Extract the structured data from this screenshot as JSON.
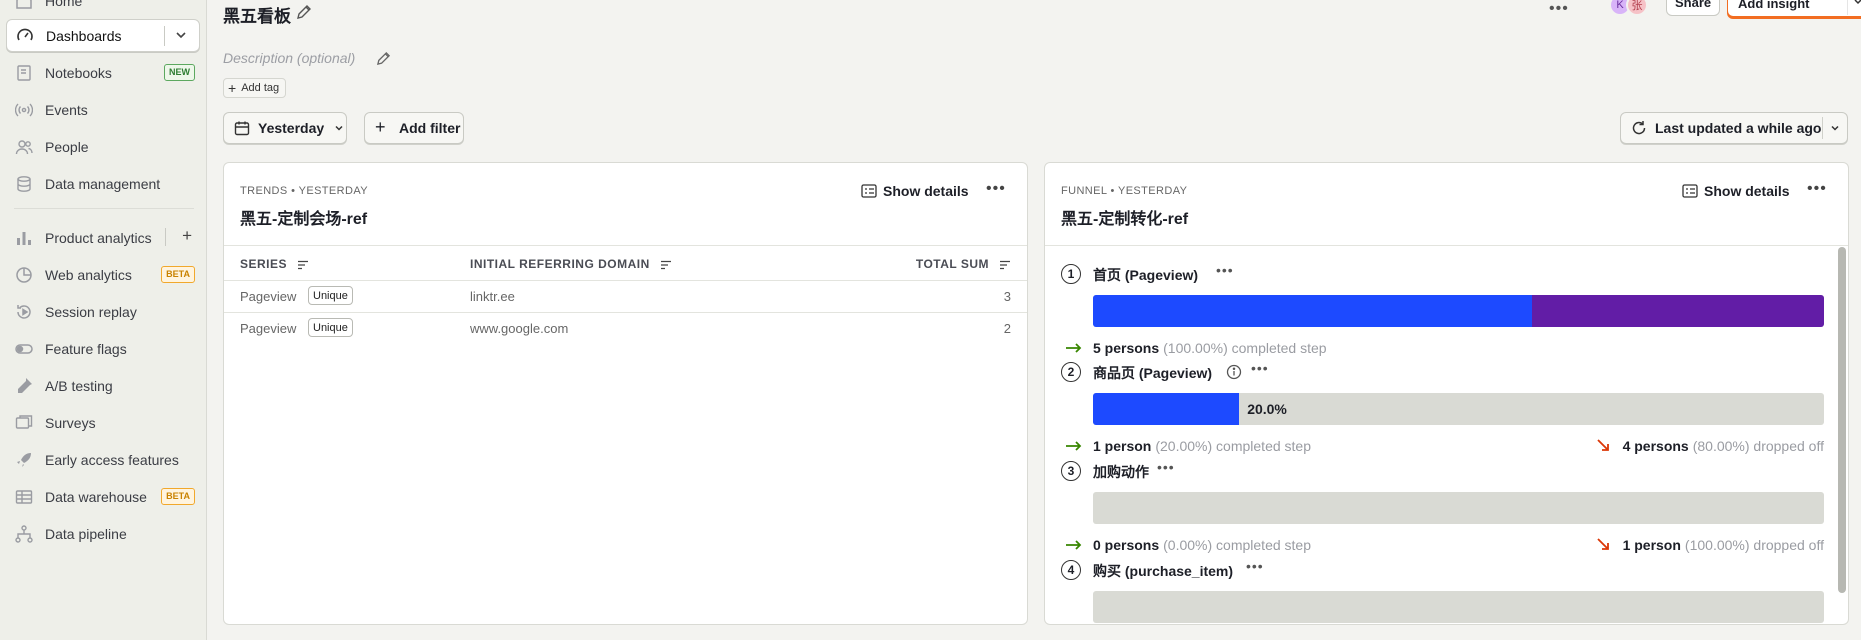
{
  "sidebar": {
    "items": [
      {
        "label": "Home",
        "icon": "home-icon"
      },
      {
        "label": "Dashboards",
        "icon": "dashboard-gauge-icon",
        "active": true
      },
      {
        "label": "Notebooks",
        "icon": "notebook-icon",
        "badge": "NEW"
      },
      {
        "label": "Events",
        "icon": "live-events-icon"
      },
      {
        "label": "People",
        "icon": "people-icon"
      },
      {
        "label": "Data management",
        "icon": "database-icon"
      },
      {
        "label": "Product analytics",
        "icon": "bar-chart-icon"
      },
      {
        "label": "Web analytics",
        "icon": "pie-chart-icon",
        "badge": "BETA"
      },
      {
        "label": "Session replay",
        "icon": "replay-icon"
      },
      {
        "label": "Feature flags",
        "icon": "toggle-icon"
      },
      {
        "label": "A/B testing",
        "icon": "flask-icon"
      },
      {
        "label": "Surveys",
        "icon": "survey-chat-icon"
      },
      {
        "label": "Early access features",
        "icon": "rocket-icon"
      },
      {
        "label": "Data warehouse",
        "icon": "warehouse-table-icon",
        "badge": "BETA"
      },
      {
        "label": "Data pipeline",
        "icon": "pipeline-icon"
      }
    ]
  },
  "header": {
    "title": "黑五看板",
    "description_placeholder": "Description (optional)",
    "add_tag_label": "Add tag",
    "share_label": "Share",
    "add_insight_label": "Add insight",
    "avatars": [
      {
        "initial": "K",
        "color": "#d8b4f8",
        "text_color": "#6b2fa0"
      },
      {
        "initial": "张",
        "color": "#f6c2c7",
        "text_color": "#b03b4a"
      }
    ]
  },
  "toolbar": {
    "date_label": "Yesterday",
    "add_filter_label": "Add filter",
    "last_updated_label": "Last updated a while ago"
  },
  "cards": {
    "trends": {
      "meta": "TRENDS • YESTERDAY",
      "title": "黑五-定制会场-ref",
      "show_details_label": "Show details",
      "columns": [
        "SERIES",
        "INITIAL REFERRING DOMAIN",
        "TOTAL SUM"
      ],
      "rows": [
        {
          "series": "Pageview",
          "tag": "Unique",
          "domain": "linktr.ee",
          "sum": "3"
        },
        {
          "series": "Pageview",
          "tag": "Unique",
          "domain": "www.google.com",
          "sum": "2"
        }
      ]
    },
    "funnel": {
      "meta": "FUNNEL • YESTERDAY",
      "title": "黑五-定制转化-ref",
      "show_details_label": "Show details",
      "colors": {
        "primary": "#1d4aff",
        "secondary": "#621da6",
        "empty": "#d9dad4",
        "completed_arrow": "#388600",
        "dropped_arrow": "#db3707"
      },
      "steps": [
        {
          "num": "1",
          "name": "首页 (Pageview)",
          "conversion": 1.0,
          "bar_label": "",
          "completed_count": "5 persons",
          "completed_pct": "(100.00%) completed step",
          "dropped_count": "",
          "dropped_pct": ""
        },
        {
          "num": "2",
          "name": "商品页 (Pageview)",
          "conversion": 0.2,
          "bar_label": "20.0%",
          "completed_count": "1 person",
          "completed_pct": "(20.00%) completed step",
          "dropped_count": "4 persons",
          "dropped_pct": "(80.00%) dropped off"
        },
        {
          "num": "3",
          "name": "加购动作",
          "conversion": 0.0,
          "bar_label": "",
          "completed_count": "0 persons",
          "completed_pct": "(0.00%) completed step",
          "dropped_count": "1 person",
          "dropped_pct": "(100.00%) dropped off"
        },
        {
          "num": "4",
          "name": "购买 (purchase_item)",
          "conversion": 0.0,
          "bar_label": "",
          "completed_count": "",
          "completed_pct": "",
          "dropped_count": "",
          "dropped_pct": ""
        }
      ]
    }
  }
}
